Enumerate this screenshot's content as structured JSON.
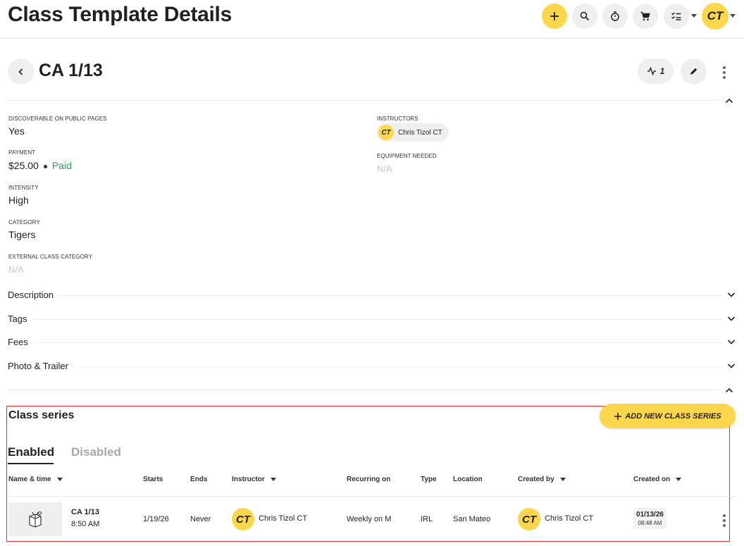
{
  "app": {
    "title": "Class Template Details",
    "avatar_initials": "CT"
  },
  "toolbar": {
    "icons": [
      "plus-icon",
      "search-icon",
      "stopwatch-icon",
      "cart-icon",
      "checklist-icon"
    ]
  },
  "header": {
    "title": "CA 1/13",
    "activity_count": "1"
  },
  "details": {
    "discoverable": {
      "label": "DISCOVERABLE ON PUBLIC PAGES",
      "value": "Yes"
    },
    "payment": {
      "label": "PAYMENT",
      "amount": "$25.00",
      "status": "Paid"
    },
    "intensity": {
      "label": "INTENSITY",
      "value": "High"
    },
    "category": {
      "label": "CATEGORY",
      "value": "Tigers"
    },
    "external_category": {
      "label": "EXTERNAL CLASS CATEGORY",
      "value": "N/A"
    },
    "instructors": {
      "label": "INSTRUCTORS",
      "name": "Chris Tizol CT",
      "initials": "CT"
    },
    "equipment": {
      "label": "EQUIPMENT NEEDED",
      "value": "N/A"
    }
  },
  "accordions": [
    "Description",
    "Tags",
    "Fees",
    "Photo & Trailer"
  ],
  "class_series": {
    "title": "Class series",
    "add_button": "ADD NEW CLASS SERIES",
    "tabs": [
      {
        "label": "Enabled",
        "active": true
      },
      {
        "label": "Disabled",
        "active": false
      }
    ],
    "columns": [
      "Name & time",
      "Starts",
      "Ends",
      "Instructor",
      "Recurring on",
      "Type",
      "Location",
      "Created by",
      "Created on"
    ],
    "rows": [
      {
        "name": "CA 1/13",
        "time": "8:50 AM",
        "starts": "1/19/26",
        "ends": "Never",
        "instructor": "Chris Tizol CT",
        "instructor_initials": "CT",
        "recurring": "Weekly on M",
        "type": "IRL",
        "location": "San Mateo",
        "created_by": "Chris Tizol CT",
        "created_by_initials": "CT",
        "created_date": "01/13/26",
        "created_time": "08:48 AM"
      }
    ]
  },
  "colors": {
    "accent": "#fcd64b",
    "paid": "#2e9c50",
    "highlight_border": "#e32b2b"
  }
}
